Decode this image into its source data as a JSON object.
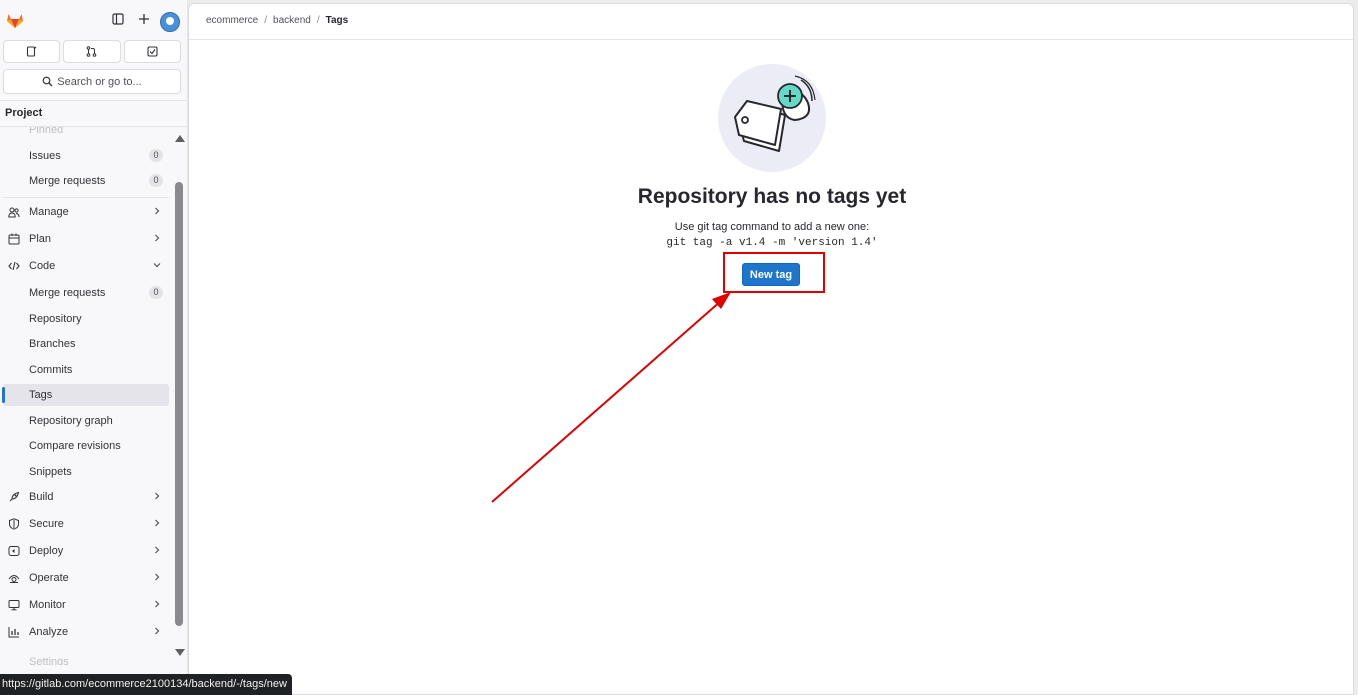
{
  "sidebar": {
    "search_label": "Search or go to...",
    "project_heading": "Project",
    "items": [
      {
        "label": "Pinned",
        "type": "ghost"
      },
      {
        "label": "Issues",
        "badge": "0",
        "type": "sub"
      },
      {
        "label": "Merge requests",
        "badge": "0",
        "type": "sub"
      },
      {
        "label": "Manage",
        "icon": "users-icon",
        "type": "group"
      },
      {
        "label": "Plan",
        "icon": "calendar-icon",
        "type": "group"
      },
      {
        "label": "Code",
        "icon": "code-icon",
        "type": "group-open"
      },
      {
        "label": "Merge requests",
        "badge": "0",
        "type": "sub"
      },
      {
        "label": "Repository",
        "type": "sub"
      },
      {
        "label": "Branches",
        "type": "sub"
      },
      {
        "label": "Commits",
        "type": "sub"
      },
      {
        "label": "Tags",
        "type": "sub",
        "active": true
      },
      {
        "label": "Repository graph",
        "type": "sub"
      },
      {
        "label": "Compare revisions",
        "type": "sub"
      },
      {
        "label": "Snippets",
        "type": "sub"
      },
      {
        "label": "Build",
        "icon": "rocket-icon",
        "type": "group"
      },
      {
        "label": "Secure",
        "icon": "shield-icon",
        "type": "group"
      },
      {
        "label": "Deploy",
        "icon": "deploy-icon",
        "type": "group"
      },
      {
        "label": "Operate",
        "icon": "operate-icon",
        "type": "group"
      },
      {
        "label": "Monitor",
        "icon": "monitor-icon",
        "type": "group"
      },
      {
        "label": "Analyze",
        "icon": "chart-icon",
        "type": "group"
      },
      {
        "label": "Settings",
        "type": "ghost"
      }
    ]
  },
  "breadcrumb": [
    "ecommerce",
    "backend",
    "Tags"
  ],
  "empty_state": {
    "title": "Repository has no tags yet",
    "description": "Use git tag command to add a new one:",
    "command": "git tag -a v1.4 -m 'version 1.4'",
    "button_label": "New tag"
  },
  "status_url": "https://gitlab.com/ecommerce2100134/backend/-/tags/new",
  "colors": {
    "accent": "#1f75cb",
    "annotation": "#e00000",
    "illustration_bg": "#ececf6",
    "illustration_plus": "#63d9c6"
  }
}
